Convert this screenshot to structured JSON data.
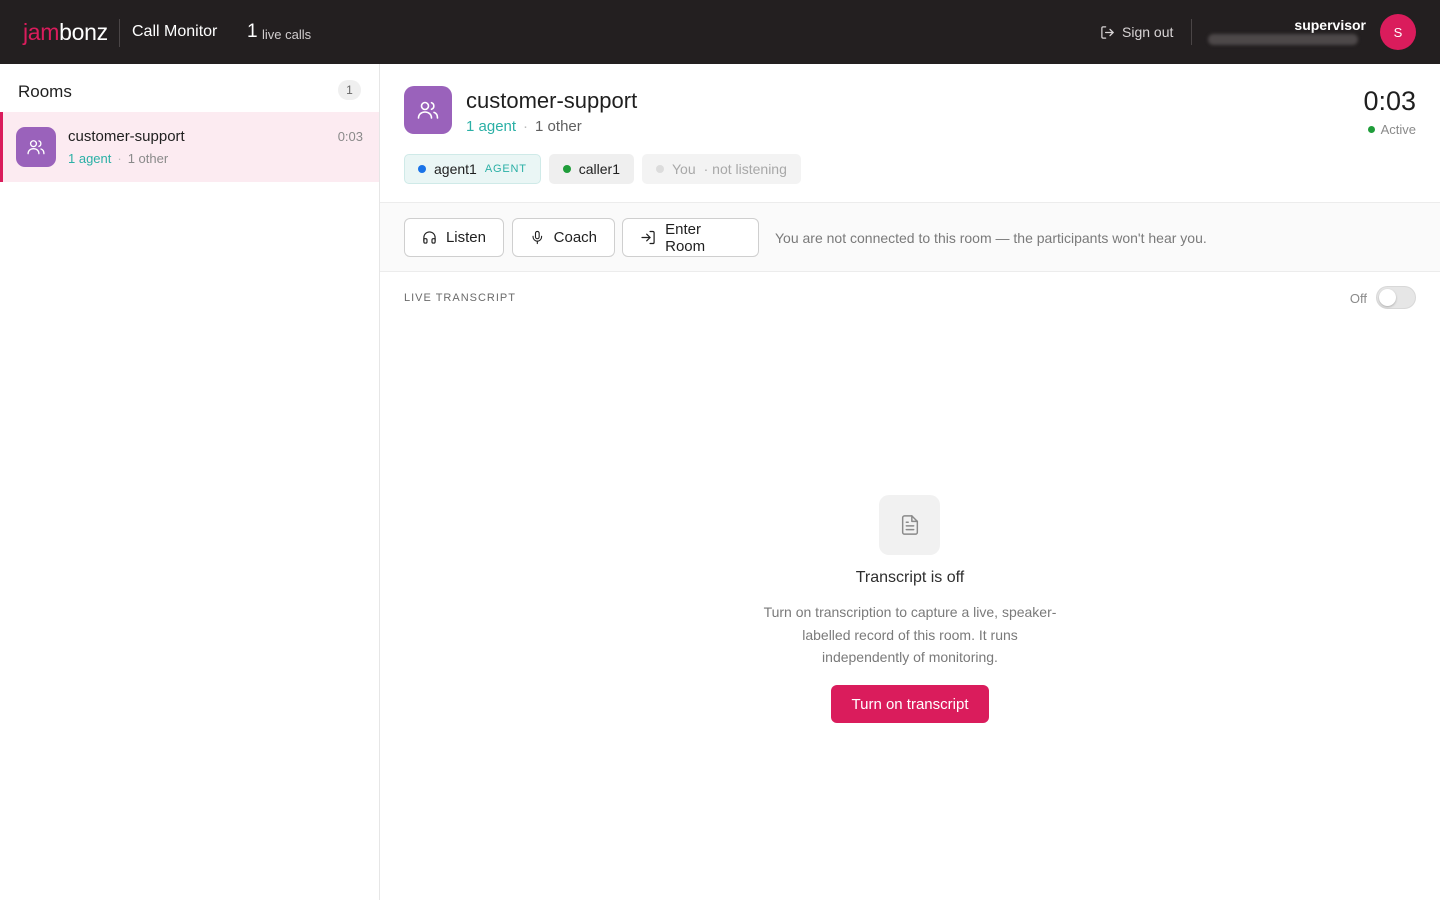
{
  "brand": {
    "logo_part1": "jam",
    "logo_part2": "bonz",
    "app_title": "Call Monitor"
  },
  "live": {
    "count": "1",
    "label": "live calls"
  },
  "header": {
    "sign_out": "Sign out",
    "user_name": "supervisor",
    "avatar_initial": "S"
  },
  "sidebar": {
    "title": "Rooms",
    "count": "1",
    "rooms": [
      {
        "name": "customer-support",
        "agents": "1 agent",
        "others": "1 other",
        "time": "0:03"
      }
    ]
  },
  "room": {
    "title": "customer-support",
    "agents": "1 agent",
    "others": "1 other",
    "timer": "0:03",
    "status": "Active",
    "participants": [
      {
        "name": "agent1",
        "role": "AGENT"
      },
      {
        "name": "caller1"
      },
      {
        "name": "You",
        "note": "· not listening"
      }
    ]
  },
  "actions": {
    "listen": "Listen",
    "coach": "Coach",
    "enter_room": "Enter Room",
    "note": "You are not connected to this room — the participants won't hear you."
  },
  "transcript": {
    "label": "LIVE TRANSCRIPT",
    "toggle_state": "Off",
    "empty_title": "Transcript is off",
    "empty_desc": "Turn on transcription to capture a live, speaker-labelled record of this room. It runs independently of monitoring.",
    "button": "Turn on transcript"
  },
  "colors": {
    "accent": "#da1c5c",
    "room_icon": "#9a62bb",
    "agent_teal": "#2bb0a6",
    "topbar": "#231f20",
    "active_green": "#1f9d3a"
  },
  "icons": {
    "room": "users-icon",
    "sign_out": "sign-out-icon",
    "listen": "headphones-icon",
    "coach": "microphone-icon",
    "enter": "enter-icon",
    "empty": "document-icon"
  }
}
